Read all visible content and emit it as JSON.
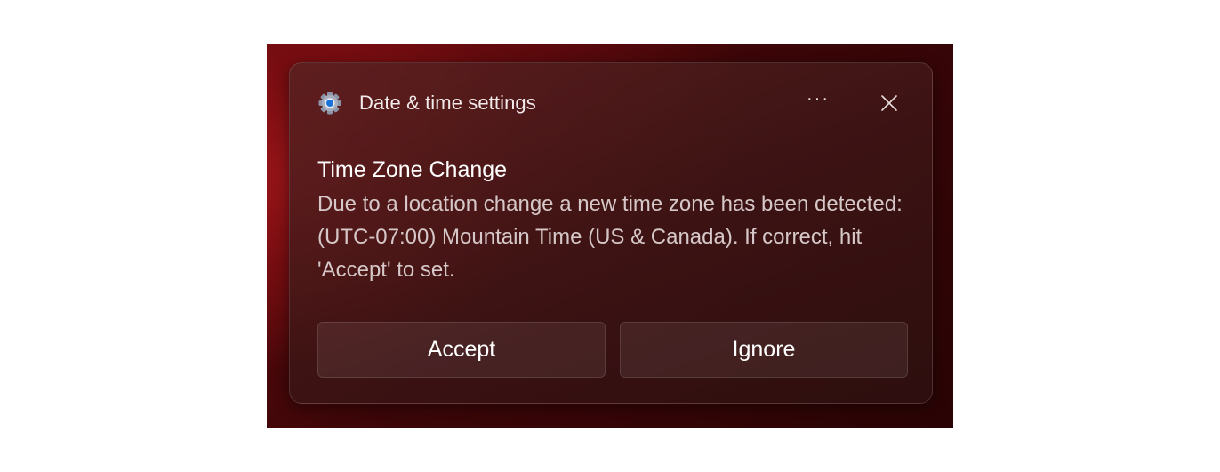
{
  "notification": {
    "app_name": "Date & time settings",
    "app_icon": "gear-icon",
    "more_label": "···",
    "close_icon": "close-icon",
    "title": "Time Zone Change",
    "body": "Due to a location change a new time zone has been detected: (UTC-07:00) Mountain Time (US & Canada). If correct, hit 'Accept' to set.",
    "actions": [
      {
        "label": "Accept"
      },
      {
        "label": "Ignore"
      }
    ]
  },
  "colors": {
    "background_accent": "#9a1519",
    "toast_surface": "#3e1616",
    "icon_accent": "#1a73d9"
  }
}
